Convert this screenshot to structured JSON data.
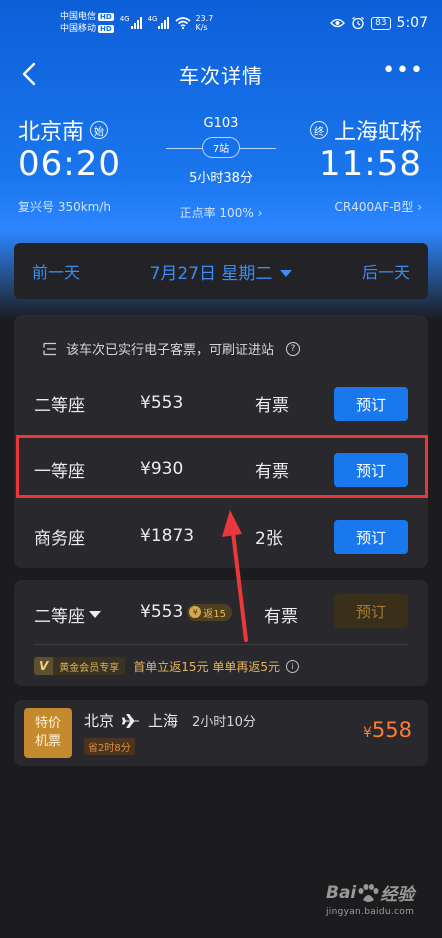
{
  "status": {
    "carrier1": "中国电信",
    "carrier2": "中国移动",
    "hd": "HD",
    "net1": "4G",
    "net2": "4G",
    "speed_value": "23.7",
    "speed_unit": "K/s",
    "battery": "83",
    "time": "5:07"
  },
  "nav": {
    "title": "车次详情",
    "more": "•••"
  },
  "route": {
    "from_station": "北京南",
    "from_tag": "始",
    "from_time": "06:20",
    "train_type": "复兴号 350km/h",
    "train_no": "G103",
    "stops": "7站",
    "duration": "5小时38分",
    "on_time": "正点率 100%",
    "to_station": "上海虹桥",
    "to_tag": "终",
    "to_time": "11:58",
    "model": "CR400AF-B型"
  },
  "date_bar": {
    "prev": "前一天",
    "current": "7月27日 星期二",
    "next": "后一天"
  },
  "notice": {
    "text": "该车次已实行电子客票，可刷证进站",
    "info": "?"
  },
  "seats": [
    {
      "name": "二等座",
      "price": "¥553",
      "availability": "有票",
      "action": "预订"
    },
    {
      "name": "一等座",
      "price": "¥930",
      "availability": "有票",
      "action": "预订"
    },
    {
      "name": "商务座",
      "price": "¥1873",
      "availability": "2张",
      "action": "预订"
    }
  ],
  "member": {
    "seat": "二等座",
    "price": "¥553",
    "rebate_coin": "¥",
    "rebate": "返15",
    "availability": "有票",
    "action": "预订",
    "vip_mark": "V",
    "vip_label": "黄金会员专享",
    "promo": "首单立返15元 单单再返5元",
    "info": "i"
  },
  "flight": {
    "badge_line1": "特价",
    "badge_line2": "机票",
    "from": "北京",
    "to": "上海",
    "duration": "2小时10分",
    "save": "省2时8分",
    "currency": "¥",
    "price": "558"
  },
  "watermark": {
    "logo_left": "Bai",
    "logo_right": "经验",
    "url": "jingyan.baidu.com"
  },
  "colors": {
    "header_blue": "#1a76ee",
    "book_blue": "#1978ed",
    "date_blue": "#3c8cf6",
    "highlight_red": "#e8383d",
    "gold": "#e6b35a",
    "flight_price": "#ff7a32"
  }
}
